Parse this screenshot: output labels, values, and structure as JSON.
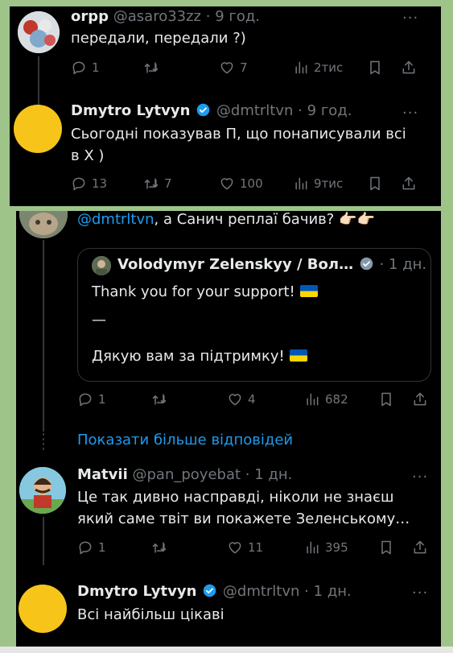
{
  "tweets": [
    {
      "name": "orpp",
      "handle": "@asaro33zz",
      "time": "9 год.",
      "text": "передали, передали ?)",
      "replies": "1",
      "retweets": "",
      "likes": "7",
      "views": "2тис"
    },
    {
      "name": "Dmytro Lytvyn",
      "handle": "@dmtrltvn",
      "time": "9 год.",
      "verified": true,
      "text_line1": "Сьогодні показував П, що понаписували всі",
      "text_line2": "в Х )",
      "replies": "13",
      "retweets": "7",
      "likes": "100",
      "views": "9тис"
    },
    {
      "mention": "@dmtrltvn",
      "text": ", а Санич реплаї бачив? 👉🏻👉🏻",
      "quote": {
        "name": "Volodymyr Zelenskyy / Вол…",
        "time": "1 дн.",
        "line1": "Thank you for your support!",
        "line2": "—",
        "line3": "Дякую вам за підтримку!"
      },
      "replies": "1",
      "retweets": "",
      "likes": "4",
      "views": "682"
    },
    {
      "name": "Matvii",
      "handle": "@pan_poyebat",
      "time": "1 дн.",
      "text_line1": "Це так дивно насправді, ніколи не знаєш",
      "text_line2": "який саме твіт ви покажете Зеленському…",
      "replies": "1",
      "retweets": "",
      "likes": "11",
      "views": "395"
    },
    {
      "name": "Dmytro Lytvyn",
      "handle": "@dmtrltvn",
      "time": "1 дн.",
      "verified": true,
      "text": "Всі найбільш цікаві"
    }
  ],
  "show_more_label": "Показати більше відповідей",
  "separator": "·",
  "more_label": "···",
  "colors": {
    "accent": "#1d9bf0",
    "verified": "#1d9bf0",
    "background": "#000000",
    "muted": "#71767b"
  },
  "icons": [
    "reply-icon",
    "retweet-icon",
    "like-icon",
    "views-icon",
    "bookmark-icon",
    "share-icon",
    "verified-badge-icon"
  ]
}
